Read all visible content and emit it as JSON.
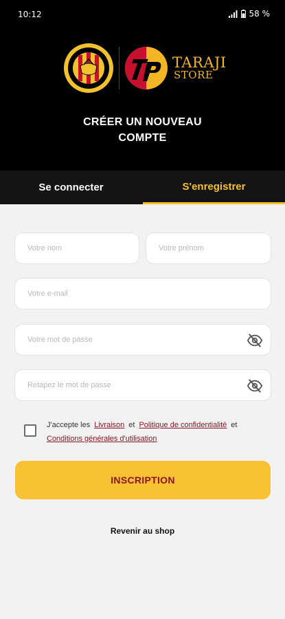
{
  "status_bar": {
    "time": "10:12",
    "battery": "58 %"
  },
  "logos": {
    "store_line1": "TARAJI",
    "store_line2": "STORE"
  },
  "title": {
    "line1": "CRÉER UN NOUVEAU",
    "line2": "COMPTE"
  },
  "tabs": [
    {
      "label": "Se connecter"
    },
    {
      "label": "S'enregistrer"
    }
  ],
  "form": {
    "last_name_placeholder": "Votre nom",
    "first_name_placeholder": "Votre prénom",
    "email_placeholder": "Votre e-mail",
    "password_placeholder": "Votre mot de passe",
    "confirm_password_placeholder": "Retapez le mot de passe"
  },
  "terms": {
    "prefix": "J'accepte les",
    "delivery_link": "Livraison",
    "and1": "et",
    "privacy_link": "Politique de confidentialité",
    "and2": "et",
    "conditions_link": "Conditions générales d'utilisation"
  },
  "submit_label": "INSCRIPTION",
  "back_label": "Revenir au shop",
  "colors": {
    "accent": "#f8c133",
    "brand_red": "#8a1522",
    "header_bg": "#000000"
  }
}
